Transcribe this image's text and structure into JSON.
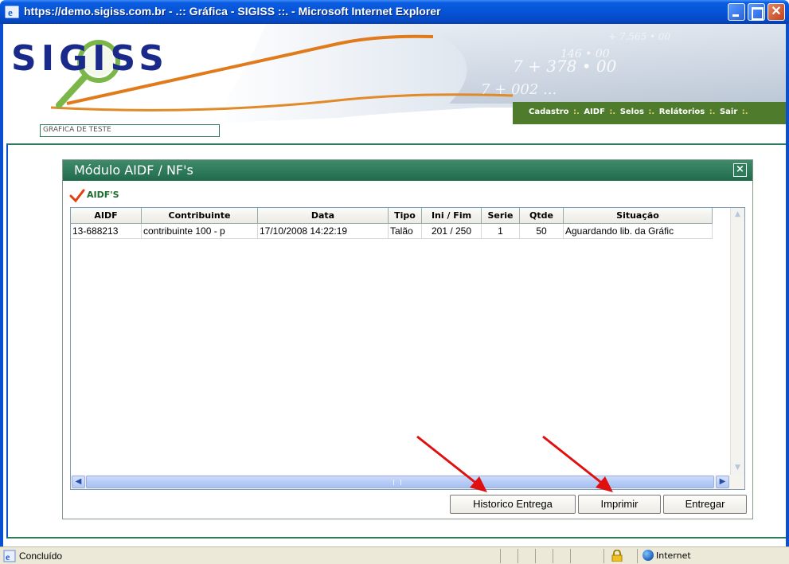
{
  "browser": {
    "title": "https://demo.sigiss.com.br - .:: Gráfica - SIGISS ::. - Microsoft Internet Explorer",
    "status_text": "Concluído",
    "zone": "Internet"
  },
  "header": {
    "logo": "SIGISS",
    "company": "GRAFICA DE TESTE",
    "nav": [
      "Cadastro",
      "AIDF",
      "Selos",
      "Relátorios",
      "Sair"
    ],
    "nav_separator": ":."
  },
  "module": {
    "title": "Módulo AIDF / NF's",
    "close_glyph": "×",
    "section": "AIDF'S",
    "columns": [
      "AIDF",
      "Contribuinte",
      "Data",
      "Tipo",
      "Ini / Fim",
      "Serie",
      "Qtde",
      "Situação"
    ],
    "rows": [
      [
        "13-688213",
        "contribuinte 100 - p",
        "17/10/2008 14:22:19",
        "Talão",
        "201 / 250",
        "1",
        "50",
        "Aguardando lib. da Gráfic"
      ]
    ],
    "buttons": {
      "historico": "Historico Entrega",
      "imprimir": "Imprimir",
      "entregar": "Entregar"
    }
  },
  "colors": {
    "module_header": "#2e7d5a",
    "nav_bar": "#4f7c2c",
    "arrow": "#e01010",
    "titlebar": "#0653d6"
  }
}
